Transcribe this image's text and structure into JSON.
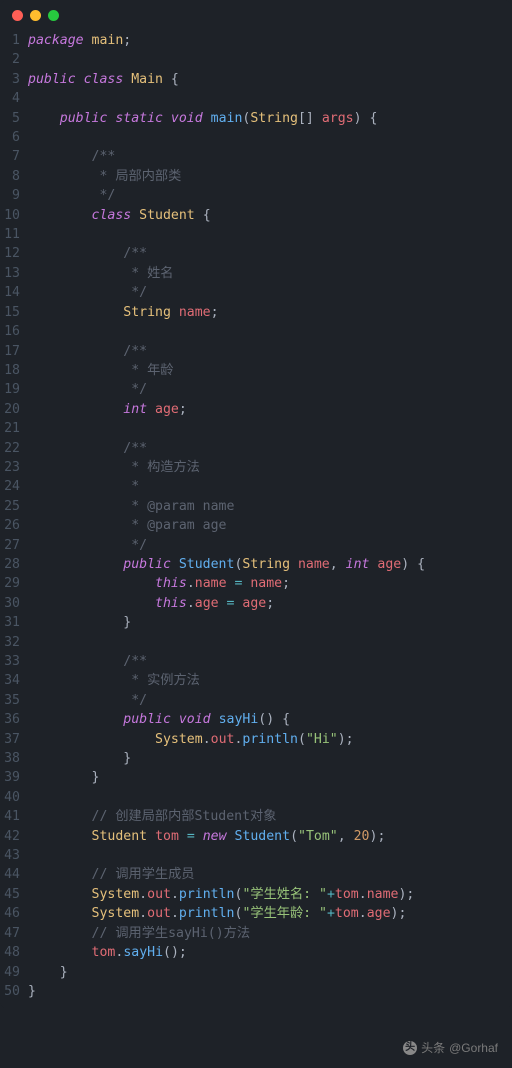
{
  "window": {
    "dots": [
      "red",
      "yellow",
      "green"
    ]
  },
  "watermark": {
    "prefix": "头条",
    "handle": "@Gorhaf"
  },
  "code": {
    "lines": [
      {
        "n": 1,
        "segs": [
          {
            "t": "package ",
            "c": "kw"
          },
          {
            "t": "main",
            "c": "type"
          },
          {
            "t": ";",
            "c": "pn"
          }
        ]
      },
      {
        "n": 2,
        "segs": []
      },
      {
        "n": 3,
        "segs": [
          {
            "t": "public class ",
            "c": "kw"
          },
          {
            "t": "Main ",
            "c": "type"
          },
          {
            "t": "{",
            "c": "pn"
          }
        ]
      },
      {
        "n": 4,
        "segs": []
      },
      {
        "n": 5,
        "segs": [
          {
            "t": "    ",
            "c": ""
          },
          {
            "t": "public static ",
            "c": "kw"
          },
          {
            "t": "void ",
            "c": "kw"
          },
          {
            "t": "main",
            "c": "fn"
          },
          {
            "t": "(",
            "c": "pn"
          },
          {
            "t": "String",
            "c": "type"
          },
          {
            "t": "[] ",
            "c": "pn"
          },
          {
            "t": "args",
            "c": "var"
          },
          {
            "t": ") {",
            "c": "pn"
          }
        ]
      },
      {
        "n": 6,
        "segs": []
      },
      {
        "n": 7,
        "segs": [
          {
            "t": "        ",
            "c": ""
          },
          {
            "t": "/**",
            "c": "cm"
          }
        ]
      },
      {
        "n": 8,
        "segs": [
          {
            "t": "         ",
            "c": ""
          },
          {
            "t": "* 局部内部类",
            "c": "cm"
          }
        ]
      },
      {
        "n": 9,
        "segs": [
          {
            "t": "         ",
            "c": ""
          },
          {
            "t": "*/",
            "c": "cm"
          }
        ]
      },
      {
        "n": 10,
        "segs": [
          {
            "t": "        ",
            "c": ""
          },
          {
            "t": "class ",
            "c": "kw"
          },
          {
            "t": "Student ",
            "c": "type"
          },
          {
            "t": "{",
            "c": "pn"
          }
        ]
      },
      {
        "n": 11,
        "segs": []
      },
      {
        "n": 12,
        "segs": [
          {
            "t": "            ",
            "c": ""
          },
          {
            "t": "/**",
            "c": "cm"
          }
        ]
      },
      {
        "n": 13,
        "segs": [
          {
            "t": "             ",
            "c": ""
          },
          {
            "t": "* 姓名",
            "c": "cm"
          }
        ]
      },
      {
        "n": 14,
        "segs": [
          {
            "t": "             ",
            "c": ""
          },
          {
            "t": "*/",
            "c": "cm"
          }
        ]
      },
      {
        "n": 15,
        "segs": [
          {
            "t": "            ",
            "c": ""
          },
          {
            "t": "String ",
            "c": "type"
          },
          {
            "t": "name",
            "c": "var"
          },
          {
            "t": ";",
            "c": "pn"
          }
        ]
      },
      {
        "n": 16,
        "segs": []
      },
      {
        "n": 17,
        "segs": [
          {
            "t": "            ",
            "c": ""
          },
          {
            "t": "/**",
            "c": "cm"
          }
        ]
      },
      {
        "n": 18,
        "segs": [
          {
            "t": "             ",
            "c": ""
          },
          {
            "t": "* 年龄",
            "c": "cm"
          }
        ]
      },
      {
        "n": 19,
        "segs": [
          {
            "t": "             ",
            "c": ""
          },
          {
            "t": "*/",
            "c": "cm"
          }
        ]
      },
      {
        "n": 20,
        "segs": [
          {
            "t": "            ",
            "c": ""
          },
          {
            "t": "int ",
            "c": "kw"
          },
          {
            "t": "age",
            "c": "var"
          },
          {
            "t": ";",
            "c": "pn"
          }
        ]
      },
      {
        "n": 21,
        "segs": []
      },
      {
        "n": 22,
        "segs": [
          {
            "t": "            ",
            "c": ""
          },
          {
            "t": "/**",
            "c": "cm"
          }
        ]
      },
      {
        "n": 23,
        "segs": [
          {
            "t": "             ",
            "c": ""
          },
          {
            "t": "* 构造方法",
            "c": "cm"
          }
        ]
      },
      {
        "n": 24,
        "segs": [
          {
            "t": "             ",
            "c": ""
          },
          {
            "t": "*",
            "c": "cm"
          }
        ]
      },
      {
        "n": 25,
        "segs": [
          {
            "t": "             ",
            "c": ""
          },
          {
            "t": "* @param name",
            "c": "cm"
          }
        ]
      },
      {
        "n": 26,
        "segs": [
          {
            "t": "             ",
            "c": ""
          },
          {
            "t": "* @param age",
            "c": "cm"
          }
        ]
      },
      {
        "n": 27,
        "segs": [
          {
            "t": "             ",
            "c": ""
          },
          {
            "t": "*/",
            "c": "cm"
          }
        ]
      },
      {
        "n": 28,
        "segs": [
          {
            "t": "            ",
            "c": ""
          },
          {
            "t": "public ",
            "c": "kw"
          },
          {
            "t": "Student",
            "c": "fn"
          },
          {
            "t": "(",
            "c": "pn"
          },
          {
            "t": "String ",
            "c": "type"
          },
          {
            "t": "name",
            "c": "var"
          },
          {
            "t": ", ",
            "c": "pn"
          },
          {
            "t": "int ",
            "c": "kw"
          },
          {
            "t": "age",
            "c": "var"
          },
          {
            "t": ") {",
            "c": "pn"
          }
        ]
      },
      {
        "n": 29,
        "segs": [
          {
            "t": "                ",
            "c": ""
          },
          {
            "t": "this",
            "c": "kw"
          },
          {
            "t": ".",
            "c": "pn"
          },
          {
            "t": "name",
            "c": "var"
          },
          {
            "t": " = ",
            "c": "op"
          },
          {
            "t": "name",
            "c": "var"
          },
          {
            "t": ";",
            "c": "pn"
          }
        ]
      },
      {
        "n": 30,
        "segs": [
          {
            "t": "                ",
            "c": ""
          },
          {
            "t": "this",
            "c": "kw"
          },
          {
            "t": ".",
            "c": "pn"
          },
          {
            "t": "age",
            "c": "var"
          },
          {
            "t": " = ",
            "c": "op"
          },
          {
            "t": "age",
            "c": "var"
          },
          {
            "t": ";",
            "c": "pn"
          }
        ]
      },
      {
        "n": 31,
        "segs": [
          {
            "t": "            ",
            "c": ""
          },
          {
            "t": "}",
            "c": "pn"
          }
        ]
      },
      {
        "n": 32,
        "segs": []
      },
      {
        "n": 33,
        "segs": [
          {
            "t": "            ",
            "c": ""
          },
          {
            "t": "/**",
            "c": "cm"
          }
        ]
      },
      {
        "n": 34,
        "segs": [
          {
            "t": "             ",
            "c": ""
          },
          {
            "t": "* 实例方法",
            "c": "cm"
          }
        ]
      },
      {
        "n": 35,
        "segs": [
          {
            "t": "             ",
            "c": ""
          },
          {
            "t": "*/",
            "c": "cm"
          }
        ]
      },
      {
        "n": 36,
        "segs": [
          {
            "t": "            ",
            "c": ""
          },
          {
            "t": "public ",
            "c": "kw"
          },
          {
            "t": "void ",
            "c": "kw"
          },
          {
            "t": "sayHi",
            "c": "fn"
          },
          {
            "t": "() {",
            "c": "pn"
          }
        ]
      },
      {
        "n": 37,
        "segs": [
          {
            "t": "                ",
            "c": ""
          },
          {
            "t": "System",
            "c": "sys"
          },
          {
            "t": ".",
            "c": "pn"
          },
          {
            "t": "out",
            "c": "var"
          },
          {
            "t": ".",
            "c": "pn"
          },
          {
            "t": "println",
            "c": "fn"
          },
          {
            "t": "(",
            "c": "pn"
          },
          {
            "t": "\"Hi\"",
            "c": "str"
          },
          {
            "t": ");",
            "c": "pn"
          }
        ]
      },
      {
        "n": 38,
        "segs": [
          {
            "t": "            ",
            "c": ""
          },
          {
            "t": "}",
            "c": "pn"
          }
        ]
      },
      {
        "n": 39,
        "segs": [
          {
            "t": "        ",
            "c": ""
          },
          {
            "t": "}",
            "c": "pn"
          }
        ]
      },
      {
        "n": 40,
        "segs": []
      },
      {
        "n": 41,
        "segs": [
          {
            "t": "        ",
            "c": ""
          },
          {
            "t": "// 创建局部内部Student对象",
            "c": "cm"
          }
        ]
      },
      {
        "n": 42,
        "segs": [
          {
            "t": "        ",
            "c": ""
          },
          {
            "t": "Student ",
            "c": "type"
          },
          {
            "t": "tom",
            "c": "var"
          },
          {
            "t": " = ",
            "c": "op"
          },
          {
            "t": "new ",
            "c": "kw"
          },
          {
            "t": "Student",
            "c": "fn"
          },
          {
            "t": "(",
            "c": "pn"
          },
          {
            "t": "\"Tom\"",
            "c": "str"
          },
          {
            "t": ", ",
            "c": "pn"
          },
          {
            "t": "20",
            "c": "num"
          },
          {
            "t": ");",
            "c": "pn"
          }
        ]
      },
      {
        "n": 43,
        "segs": []
      },
      {
        "n": 44,
        "segs": [
          {
            "t": "        ",
            "c": ""
          },
          {
            "t": "// 调用学生成员",
            "c": "cm"
          }
        ]
      },
      {
        "n": 45,
        "segs": [
          {
            "t": "        ",
            "c": ""
          },
          {
            "t": "System",
            "c": "sys"
          },
          {
            "t": ".",
            "c": "pn"
          },
          {
            "t": "out",
            "c": "var"
          },
          {
            "t": ".",
            "c": "pn"
          },
          {
            "t": "println",
            "c": "fn"
          },
          {
            "t": "(",
            "c": "pn"
          },
          {
            "t": "\"学生姓名: \"",
            "c": "str"
          },
          {
            "t": "+",
            "c": "op"
          },
          {
            "t": "tom",
            "c": "var"
          },
          {
            "t": ".",
            "c": "pn"
          },
          {
            "t": "name",
            "c": "var"
          },
          {
            "t": ");",
            "c": "pn"
          }
        ]
      },
      {
        "n": 46,
        "segs": [
          {
            "t": "        ",
            "c": ""
          },
          {
            "t": "System",
            "c": "sys"
          },
          {
            "t": ".",
            "c": "pn"
          },
          {
            "t": "out",
            "c": "var"
          },
          {
            "t": ".",
            "c": "pn"
          },
          {
            "t": "println",
            "c": "fn"
          },
          {
            "t": "(",
            "c": "pn"
          },
          {
            "t": "\"学生年龄: \"",
            "c": "str"
          },
          {
            "t": "+",
            "c": "op"
          },
          {
            "t": "tom",
            "c": "var"
          },
          {
            "t": ".",
            "c": "pn"
          },
          {
            "t": "age",
            "c": "var"
          },
          {
            "t": ");",
            "c": "pn"
          }
        ]
      },
      {
        "n": 47,
        "segs": [
          {
            "t": "        ",
            "c": ""
          },
          {
            "t": "// 调用学生sayHi()方法",
            "c": "cm"
          }
        ]
      },
      {
        "n": 48,
        "segs": [
          {
            "t": "        ",
            "c": ""
          },
          {
            "t": "tom",
            "c": "var"
          },
          {
            "t": ".",
            "c": "pn"
          },
          {
            "t": "sayHi",
            "c": "fn"
          },
          {
            "t": "();",
            "c": "pn"
          }
        ]
      },
      {
        "n": 49,
        "segs": [
          {
            "t": "    ",
            "c": ""
          },
          {
            "t": "}",
            "c": "pn"
          }
        ]
      },
      {
        "n": 50,
        "segs": [
          {
            "t": "}",
            "c": "pn"
          }
        ]
      }
    ]
  }
}
